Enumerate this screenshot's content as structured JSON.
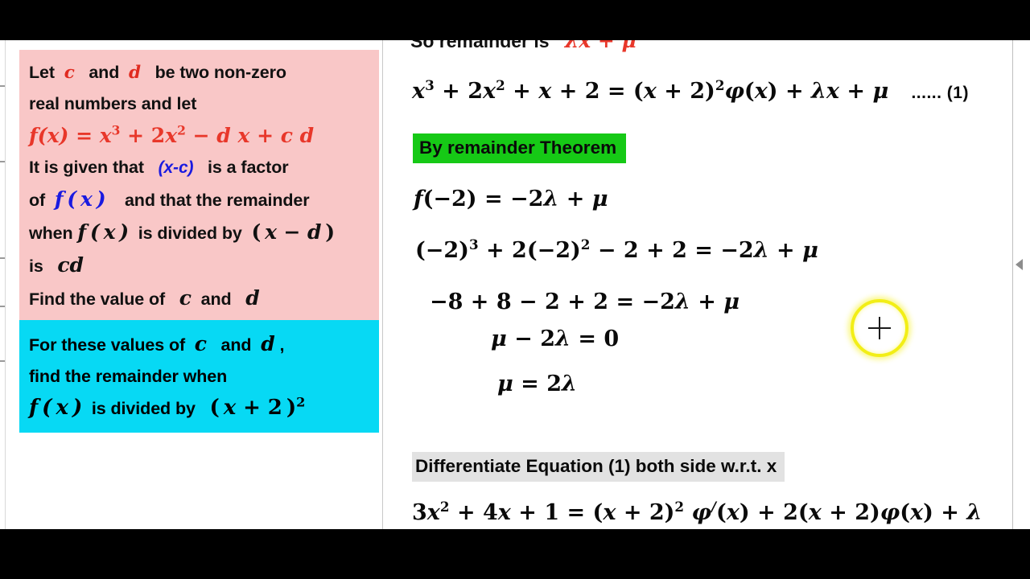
{
  "frame": {
    "letterbox_color": "#000000",
    "page_background": "#ffffff"
  },
  "left_panel": {
    "problem_box": {
      "background_color": "#f9c7c7",
      "lines": [
        {
          "id": "l1",
          "pre": "Let",
          "var1": "c",
          "mid": "and",
          "var2": "d",
          "post": "be two non-zero"
        },
        {
          "id": "l2",
          "text": "real numbers and let"
        },
        {
          "id": "l3",
          "equation": "f(x) = x³ + 2x² − dx + cd"
        },
        {
          "id": "l4",
          "pre": "It is given that",
          "factor": "(x-c)",
          "post": "is a factor"
        },
        {
          "id": "l5",
          "pre": "of",
          "fx": "f(x)",
          "post": "and that the remainder"
        },
        {
          "id": "l6",
          "pre": "when",
          "fx": "f(x)",
          "mid": "is divided by",
          "divisor": "(x − d)"
        },
        {
          "id": "l7",
          "pre": "is",
          "value": "cd"
        },
        {
          "id": "l8",
          "pre": "Find the value of",
          "var1": "c",
          "mid": "and",
          "var2": "d"
        }
      ]
    },
    "task_box": {
      "background_color": "#07d9f4",
      "lines": [
        {
          "id": "t1",
          "pre": "For these values of",
          "var1": "c",
          "mid": "and",
          "var2": "d",
          "post": ","
        },
        {
          "id": "t2",
          "text": "find the remainder  when"
        },
        {
          "id": "t3",
          "fx": "f(x)",
          "mid": "is  divided by",
          "divisor": "(x + 2)²"
        }
      ]
    }
  },
  "right_panel": {
    "cutoff_line": {
      "text": "So remainder is",
      "math": "λx + μ"
    },
    "main_equation": {
      "expr": "x³ + 2x² + x + 2 = (x + 2)²φ(x) + λx + μ",
      "tag": "...... (1)"
    },
    "theorem_banner": {
      "label": "By remainder Theorem",
      "background_color": "#16c916"
    },
    "steps": [
      {
        "id": "s1",
        "expr": "f(−2) = −2λ + μ"
      },
      {
        "id": "s2",
        "expr": "(−2)³ + 2(−2)² − 2 + 2 = −2λ + μ"
      },
      {
        "id": "s3",
        "expr": "−8 + 8 − 2 + 2 = −2λ + μ"
      },
      {
        "id": "s4",
        "expr": "μ − 2λ = 0"
      },
      {
        "id": "s5",
        "expr": "μ = 2λ"
      }
    ],
    "differentiate_banner": {
      "label": "Differentiate Equation  (1)  both side   w.r.t. x",
      "background_color": "#e2e2e2"
    },
    "derivative_equation": {
      "expr": "3x² + 4x + 1 = (x + 2)² φ′(x) + 2(x + 2)φ(x) + λ"
    }
  },
  "annotations": {
    "highlight_cursor": {
      "ring_color": "#f2ee16",
      "shape": "circle-with-crosshair"
    },
    "collapse_arrow": {
      "direction": "left",
      "color": "#8d8d8d"
    }
  }
}
